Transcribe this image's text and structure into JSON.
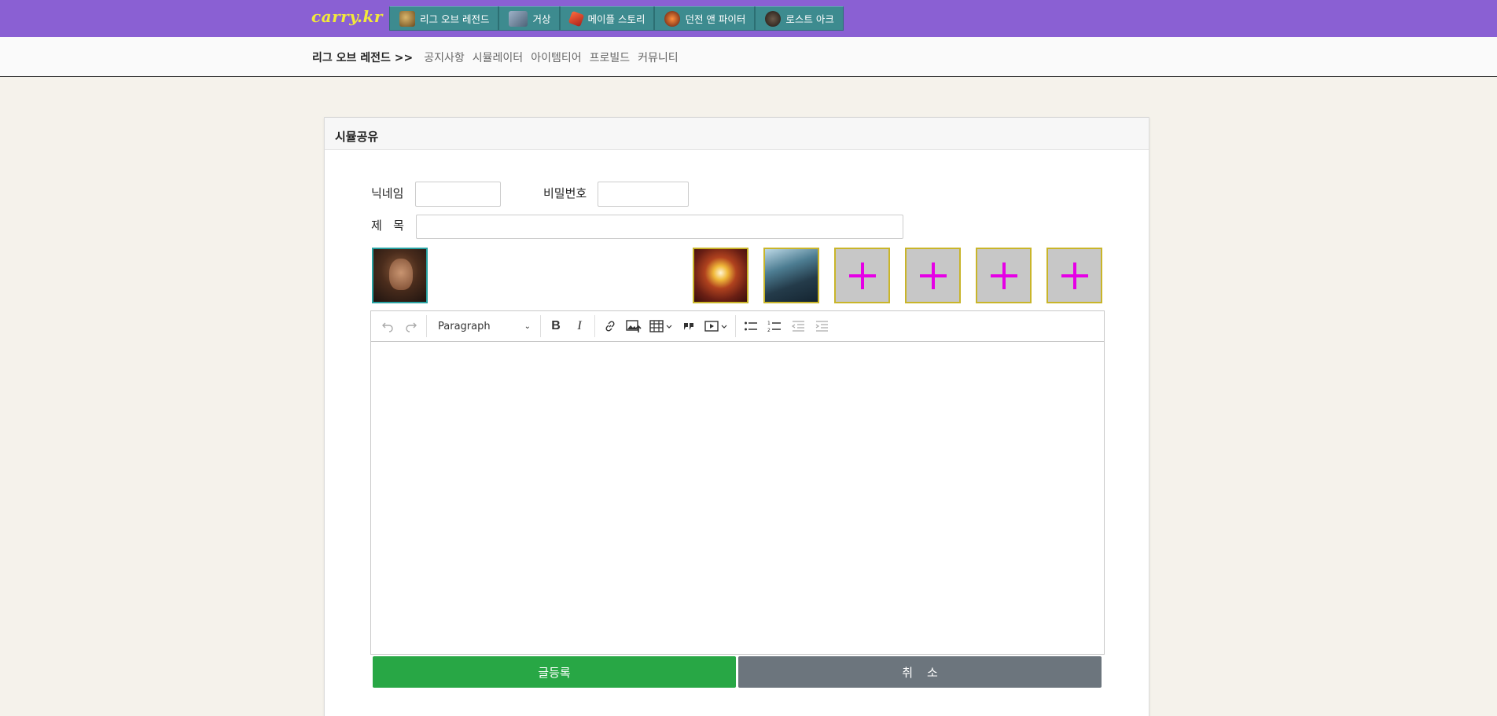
{
  "site": {
    "logo": "carry.kr"
  },
  "game_tabs": [
    {
      "label": "리그 오브 레전드",
      "icon": "lol-icon"
    },
    {
      "label": "거상",
      "icon": "gersang-icon"
    },
    {
      "label": "메이플 스토리",
      "icon": "maplestory-icon"
    },
    {
      "label": "던전 앤 파이터",
      "icon": "dnf-icon"
    },
    {
      "label": "로스트 아크",
      "icon": "lostark-icon"
    }
  ],
  "subnav": {
    "game": "리그 오브 레전드 >>",
    "links": [
      "공지사항",
      "시뮬레이터",
      "아이템티어",
      "프로빌드",
      "커뮤니티"
    ]
  },
  "form": {
    "title": "시뮬공유",
    "nickname_label": "닉네임",
    "nickname_value": "",
    "password_label": "비밀번호",
    "password_value": "",
    "subject_label": "제   목",
    "subject_value": ""
  },
  "editor": {
    "block_format": "Paragraph",
    "content": ""
  },
  "buttons": {
    "submit": "글등록",
    "cancel": "취소"
  },
  "colors": {
    "topbar": "#8a60d3",
    "tab": "#3d8b8f",
    "submit": "#28a745",
    "cancel": "#6c757d",
    "plus": "#e600e6"
  }
}
